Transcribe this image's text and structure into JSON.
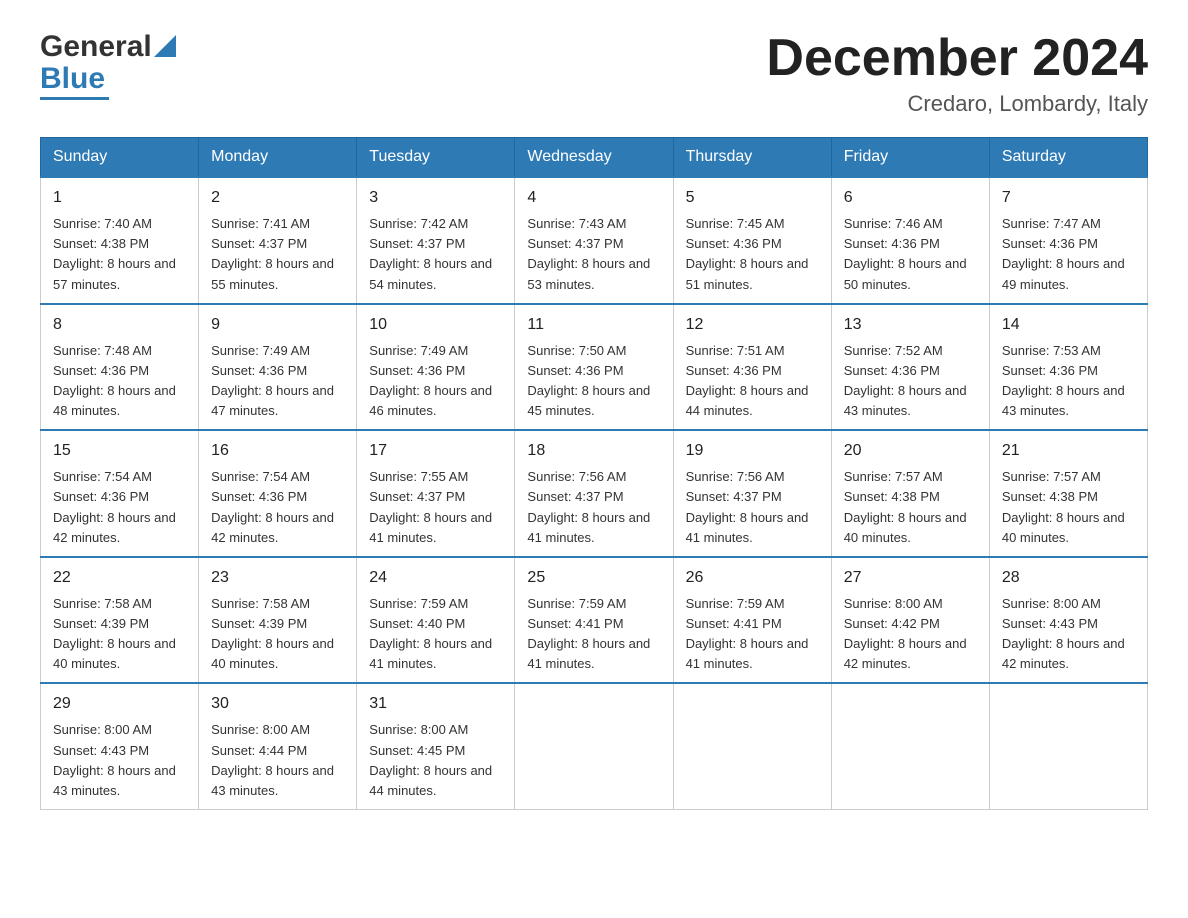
{
  "header": {
    "logo_general": "General",
    "logo_blue": "Blue",
    "month_title": "December 2024",
    "subtitle": "Credaro, Lombardy, Italy"
  },
  "days_of_week": [
    "Sunday",
    "Monday",
    "Tuesday",
    "Wednesday",
    "Thursday",
    "Friday",
    "Saturday"
  ],
  "weeks": [
    [
      {
        "day": "1",
        "sunrise": "Sunrise: 7:40 AM",
        "sunset": "Sunset: 4:38 PM",
        "daylight": "Daylight: 8 hours and 57 minutes."
      },
      {
        "day": "2",
        "sunrise": "Sunrise: 7:41 AM",
        "sunset": "Sunset: 4:37 PM",
        "daylight": "Daylight: 8 hours and 55 minutes."
      },
      {
        "day": "3",
        "sunrise": "Sunrise: 7:42 AM",
        "sunset": "Sunset: 4:37 PM",
        "daylight": "Daylight: 8 hours and 54 minutes."
      },
      {
        "day": "4",
        "sunrise": "Sunrise: 7:43 AM",
        "sunset": "Sunset: 4:37 PM",
        "daylight": "Daylight: 8 hours and 53 minutes."
      },
      {
        "day": "5",
        "sunrise": "Sunrise: 7:45 AM",
        "sunset": "Sunset: 4:36 PM",
        "daylight": "Daylight: 8 hours and 51 minutes."
      },
      {
        "day": "6",
        "sunrise": "Sunrise: 7:46 AM",
        "sunset": "Sunset: 4:36 PM",
        "daylight": "Daylight: 8 hours and 50 minutes."
      },
      {
        "day": "7",
        "sunrise": "Sunrise: 7:47 AM",
        "sunset": "Sunset: 4:36 PM",
        "daylight": "Daylight: 8 hours and 49 minutes."
      }
    ],
    [
      {
        "day": "8",
        "sunrise": "Sunrise: 7:48 AM",
        "sunset": "Sunset: 4:36 PM",
        "daylight": "Daylight: 8 hours and 48 minutes."
      },
      {
        "day": "9",
        "sunrise": "Sunrise: 7:49 AM",
        "sunset": "Sunset: 4:36 PM",
        "daylight": "Daylight: 8 hours and 47 minutes."
      },
      {
        "day": "10",
        "sunrise": "Sunrise: 7:49 AM",
        "sunset": "Sunset: 4:36 PM",
        "daylight": "Daylight: 8 hours and 46 minutes."
      },
      {
        "day": "11",
        "sunrise": "Sunrise: 7:50 AM",
        "sunset": "Sunset: 4:36 PM",
        "daylight": "Daylight: 8 hours and 45 minutes."
      },
      {
        "day": "12",
        "sunrise": "Sunrise: 7:51 AM",
        "sunset": "Sunset: 4:36 PM",
        "daylight": "Daylight: 8 hours and 44 minutes."
      },
      {
        "day": "13",
        "sunrise": "Sunrise: 7:52 AM",
        "sunset": "Sunset: 4:36 PM",
        "daylight": "Daylight: 8 hours and 43 minutes."
      },
      {
        "day": "14",
        "sunrise": "Sunrise: 7:53 AM",
        "sunset": "Sunset: 4:36 PM",
        "daylight": "Daylight: 8 hours and 43 minutes."
      }
    ],
    [
      {
        "day": "15",
        "sunrise": "Sunrise: 7:54 AM",
        "sunset": "Sunset: 4:36 PM",
        "daylight": "Daylight: 8 hours and 42 minutes."
      },
      {
        "day": "16",
        "sunrise": "Sunrise: 7:54 AM",
        "sunset": "Sunset: 4:36 PM",
        "daylight": "Daylight: 8 hours and 42 minutes."
      },
      {
        "day": "17",
        "sunrise": "Sunrise: 7:55 AM",
        "sunset": "Sunset: 4:37 PM",
        "daylight": "Daylight: 8 hours and 41 minutes."
      },
      {
        "day": "18",
        "sunrise": "Sunrise: 7:56 AM",
        "sunset": "Sunset: 4:37 PM",
        "daylight": "Daylight: 8 hours and 41 minutes."
      },
      {
        "day": "19",
        "sunrise": "Sunrise: 7:56 AM",
        "sunset": "Sunset: 4:37 PM",
        "daylight": "Daylight: 8 hours and 41 minutes."
      },
      {
        "day": "20",
        "sunrise": "Sunrise: 7:57 AM",
        "sunset": "Sunset: 4:38 PM",
        "daylight": "Daylight: 8 hours and 40 minutes."
      },
      {
        "day": "21",
        "sunrise": "Sunrise: 7:57 AM",
        "sunset": "Sunset: 4:38 PM",
        "daylight": "Daylight: 8 hours and 40 minutes."
      }
    ],
    [
      {
        "day": "22",
        "sunrise": "Sunrise: 7:58 AM",
        "sunset": "Sunset: 4:39 PM",
        "daylight": "Daylight: 8 hours and 40 minutes."
      },
      {
        "day": "23",
        "sunrise": "Sunrise: 7:58 AM",
        "sunset": "Sunset: 4:39 PM",
        "daylight": "Daylight: 8 hours and 40 minutes."
      },
      {
        "day": "24",
        "sunrise": "Sunrise: 7:59 AM",
        "sunset": "Sunset: 4:40 PM",
        "daylight": "Daylight: 8 hours and 41 minutes."
      },
      {
        "day": "25",
        "sunrise": "Sunrise: 7:59 AM",
        "sunset": "Sunset: 4:41 PM",
        "daylight": "Daylight: 8 hours and 41 minutes."
      },
      {
        "day": "26",
        "sunrise": "Sunrise: 7:59 AM",
        "sunset": "Sunset: 4:41 PM",
        "daylight": "Daylight: 8 hours and 41 minutes."
      },
      {
        "day": "27",
        "sunrise": "Sunrise: 8:00 AM",
        "sunset": "Sunset: 4:42 PM",
        "daylight": "Daylight: 8 hours and 42 minutes."
      },
      {
        "day": "28",
        "sunrise": "Sunrise: 8:00 AM",
        "sunset": "Sunset: 4:43 PM",
        "daylight": "Daylight: 8 hours and 42 minutes."
      }
    ],
    [
      {
        "day": "29",
        "sunrise": "Sunrise: 8:00 AM",
        "sunset": "Sunset: 4:43 PM",
        "daylight": "Daylight: 8 hours and 43 minutes."
      },
      {
        "day": "30",
        "sunrise": "Sunrise: 8:00 AM",
        "sunset": "Sunset: 4:44 PM",
        "daylight": "Daylight: 8 hours and 43 minutes."
      },
      {
        "day": "31",
        "sunrise": "Sunrise: 8:00 AM",
        "sunset": "Sunset: 4:45 PM",
        "daylight": "Daylight: 8 hours and 44 minutes."
      },
      null,
      null,
      null,
      null
    ]
  ]
}
